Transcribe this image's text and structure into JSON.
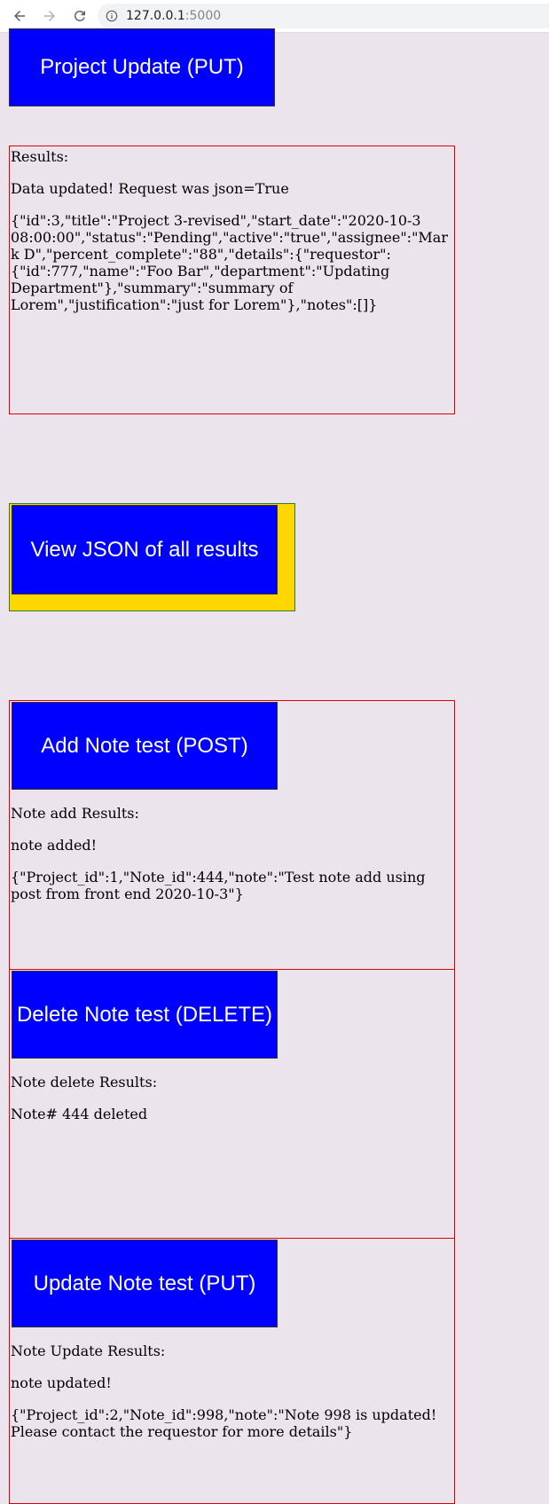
{
  "browser": {
    "url_host": "127.0.0.1",
    "url_port": ":5000"
  },
  "project_update": {
    "button_label": "Project Update (PUT)",
    "results_label": "Results:",
    "message": "Data updated! Request was json=True",
    "json": "{\"id\":3,\"title\":\"Project 3-revised\",\"start_date\":\"2020-10-3 08:00:00\",\"status\":\"Pending\",\"active\":\"true\",\"assignee\":\"Mark D\",\"percent_complete\":\"88\",\"details\":{\"requestor\":{\"id\":777,\"name\":\"Foo Bar\",\"department\":\"Updating Department\"},\"summary\":\"summary of Lorem\",\"justification\":\"just for Lorem\"},\"notes\":[]}"
  },
  "view_json": {
    "button_label": "View JSON of all results"
  },
  "add_note": {
    "button_label": "Add Note test (POST)",
    "results_label": "Note add Results:",
    "message": "note added!",
    "json": "{\"Project_id\":1,\"Note_id\":444,\"note\":\"Test note add using post from front end 2020-10-3\"}"
  },
  "delete_note": {
    "button_label": "Delete Note test (DELETE)",
    "results_label": "Note delete Results:",
    "message": "Note# 444 deleted"
  },
  "update_note": {
    "button_label": "Update Note test (PUT)",
    "results_label": "Note Update Results:",
    "message": "note updated!",
    "json": "{\"Project_id\":2,\"Note_id\":998,\"note\":\"Note 998 is updated! Please contact the requestor for more details\"}"
  }
}
